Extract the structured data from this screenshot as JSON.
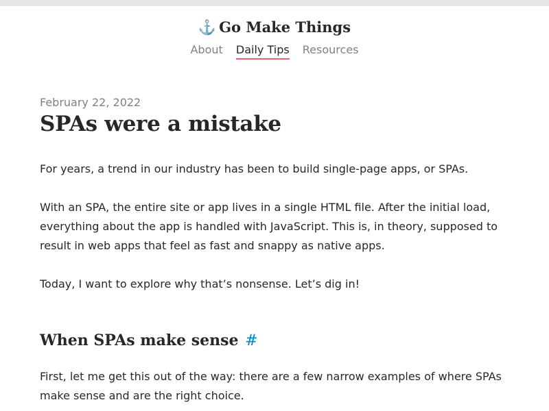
{
  "site": {
    "anchor_glyph": "⚓",
    "name": "Go Make Things"
  },
  "nav": {
    "items": [
      {
        "label": "About"
      },
      {
        "label": "Daily Tips",
        "active": true
      },
      {
        "label": "Resources"
      }
    ]
  },
  "article": {
    "date": "February 22, 2022",
    "title": "SPAs were a mistake",
    "paragraphs": [
      "For years, a trend in our industry has been to build single-page apps, or SPAs.",
      "With an SPA, the entire site or app lives in a single HTML file. After the initial load, everything about the app is handled with JavaScript. This is, in theory, supposed to result in web apps that feel as fast and snappy as native apps.",
      "Today, I want to explore why that’s nonsense. Let’s dig in!"
    ],
    "section": {
      "heading": "When SPAs make sense",
      "anchor_link": "#",
      "paragraph": "First, let me get this out of the way: there are a few narrow examples of where SPAs make sense and are the right choice."
    }
  },
  "colors": {
    "accent_underline": "#f05f6f",
    "link": "#0088cc",
    "muted": "#808080",
    "text": "#272727",
    "top_bar": "#e6e6e6"
  }
}
